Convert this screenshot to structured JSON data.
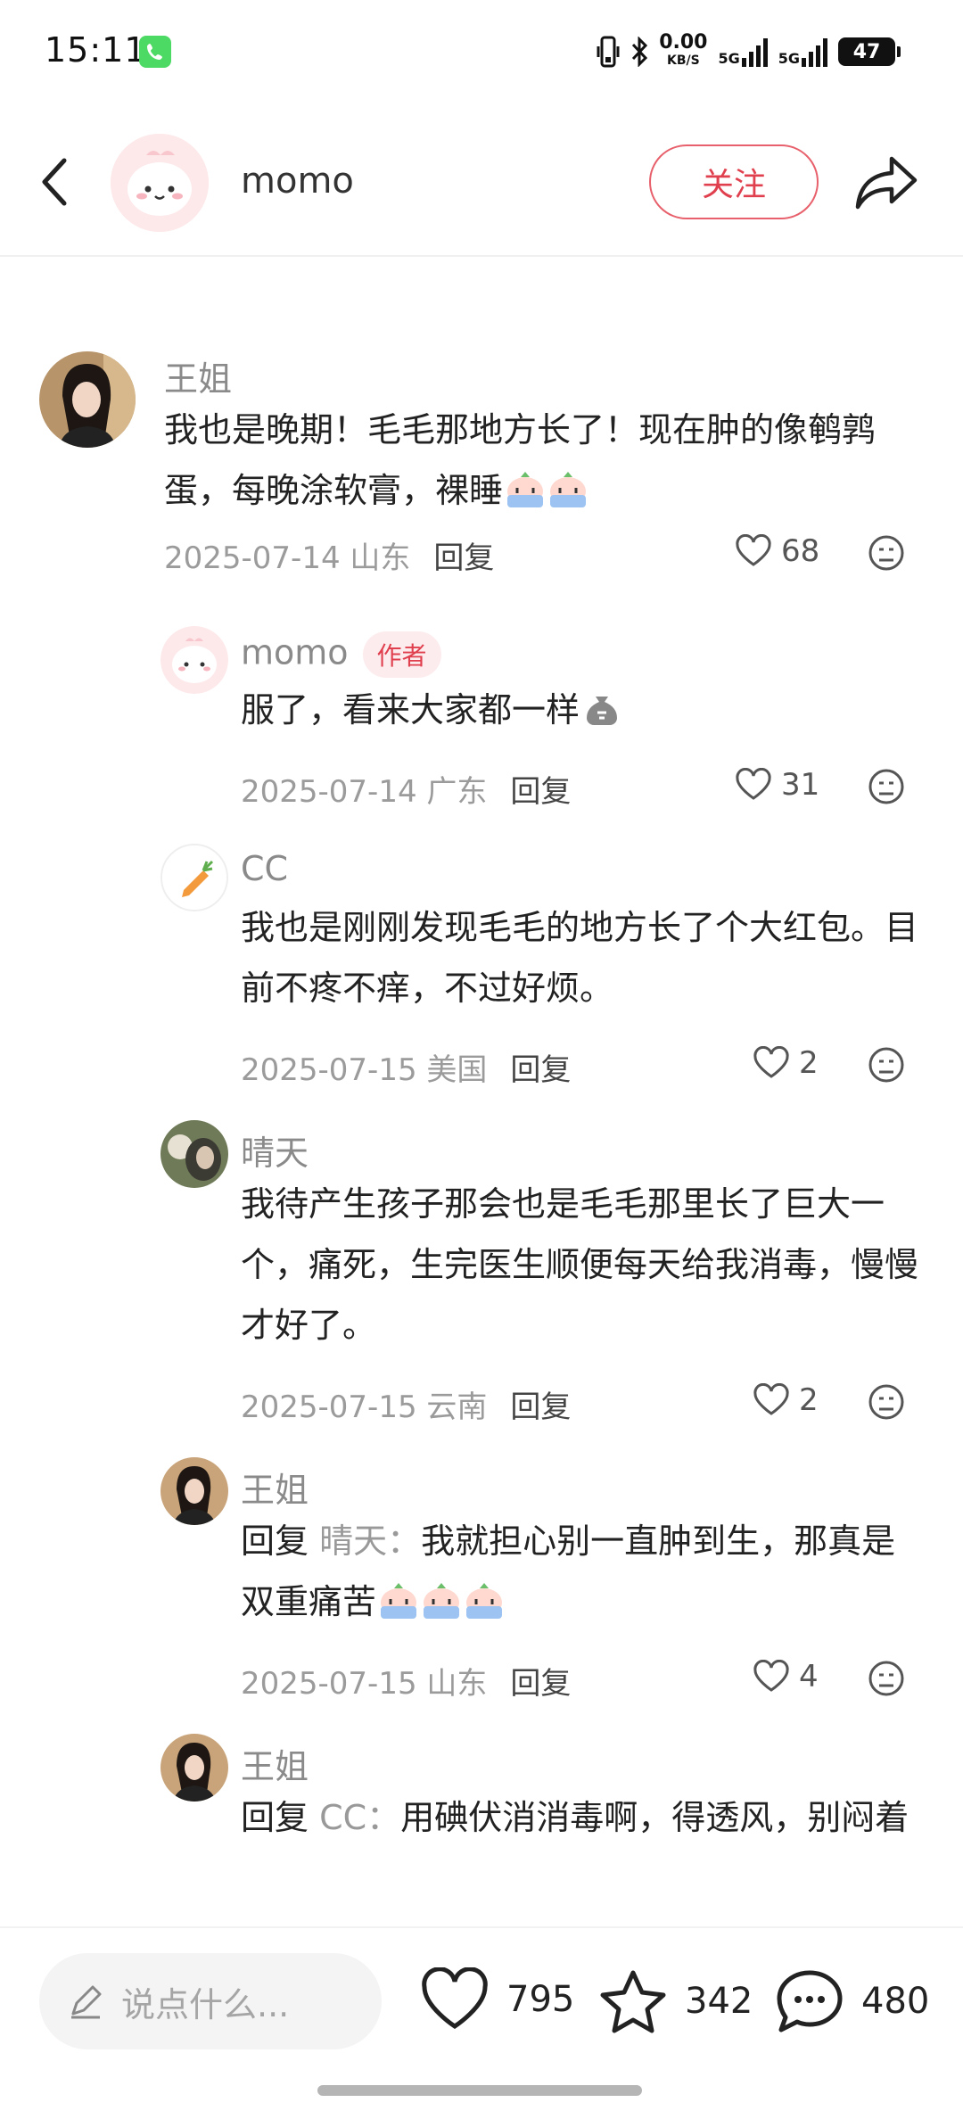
{
  "status_bar": {
    "time": "15:11",
    "net_speed": "0.00",
    "net_unit": "KB/S",
    "sig1_label": "5G",
    "sig2_label": "5G",
    "battery": "47"
  },
  "header": {
    "author_name": "momo",
    "follow_label": "关注"
  },
  "comments": [
    {
      "name": "王姐",
      "text": "我也是晚期！毛毛那地方长了！现在肿的像鹌鹑蛋，每晚涂软膏，裸睡",
      "date_loc": "2025-07-14 山东",
      "reply_label": "回复",
      "likes": "68"
    },
    {
      "name": "momo",
      "author_tag": "作者",
      "text": "服了，看来大家都一样",
      "date_loc": "2025-07-14 广东",
      "reply_label": "回复",
      "likes": "31"
    },
    {
      "name": "CC",
      "text": "我也是刚刚发现毛毛的地方长了个大红包。目前不疼不痒，不过好烦。",
      "date_loc": "2025-07-15 美国",
      "reply_label": "回复",
      "likes": "2"
    },
    {
      "name": "晴天",
      "text": "我待产生孩子那会也是毛毛那里长了巨大一个，痛死，生完医生顺便每天给我消毒，慢慢才好了。",
      "date_loc": "2025-07-15 云南",
      "reply_label": "回复",
      "likes": "2"
    },
    {
      "name": "王姐",
      "reply_prefix": "回复",
      "reply_target": "晴天：",
      "text": "我就担心别一直肿到生，那真是双重痛苦",
      "date_loc": "2025-07-15 山东",
      "reply_label": "回复",
      "likes": "4"
    },
    {
      "name": "王姐",
      "reply_prefix": "回复",
      "reply_target": "CC：",
      "text": "用碘伏消消毒啊，得透风，别闷着"
    }
  ],
  "bottom_bar": {
    "input_placeholder": "说点什么...",
    "likes_count": "795",
    "stars_count": "342",
    "comments_count": "480"
  },
  "colors": {
    "accent": "#e0404e",
    "tag_bg": "#fdecee",
    "meta_gray": "#9b9b9b"
  },
  "icons": [
    "back-arrow-icon",
    "share-icon",
    "heart-icon",
    "dislike-face-icon",
    "pencil-icon",
    "star-icon",
    "chat-bubble-icon",
    "phone-icon",
    "bluetooth-icon",
    "vibrate-icon"
  ]
}
